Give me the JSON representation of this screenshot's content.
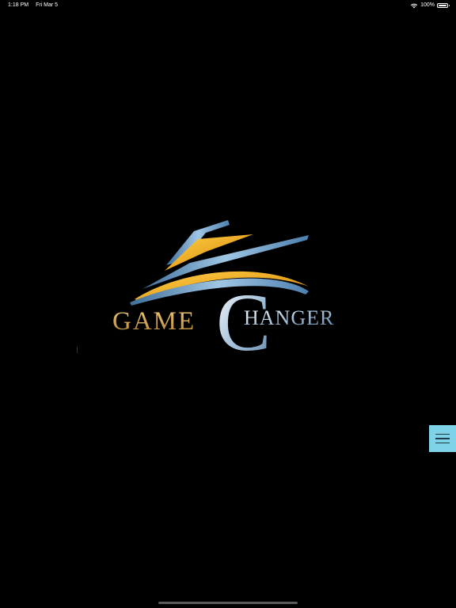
{
  "status_bar": {
    "time": "1:18 PM",
    "date": "Fri Mar 5",
    "battery": "100%"
  },
  "logo": {
    "word_left": "GAME",
    "letter_big": "C",
    "word_right": "HANGER",
    "colors": {
      "gold": "#c9a24a",
      "blue": "#8fb8d8",
      "silver": "#e8eef4"
    }
  },
  "menu_button": {
    "icon": "hamburger-menu-icon",
    "color": "#7fd3e8"
  }
}
